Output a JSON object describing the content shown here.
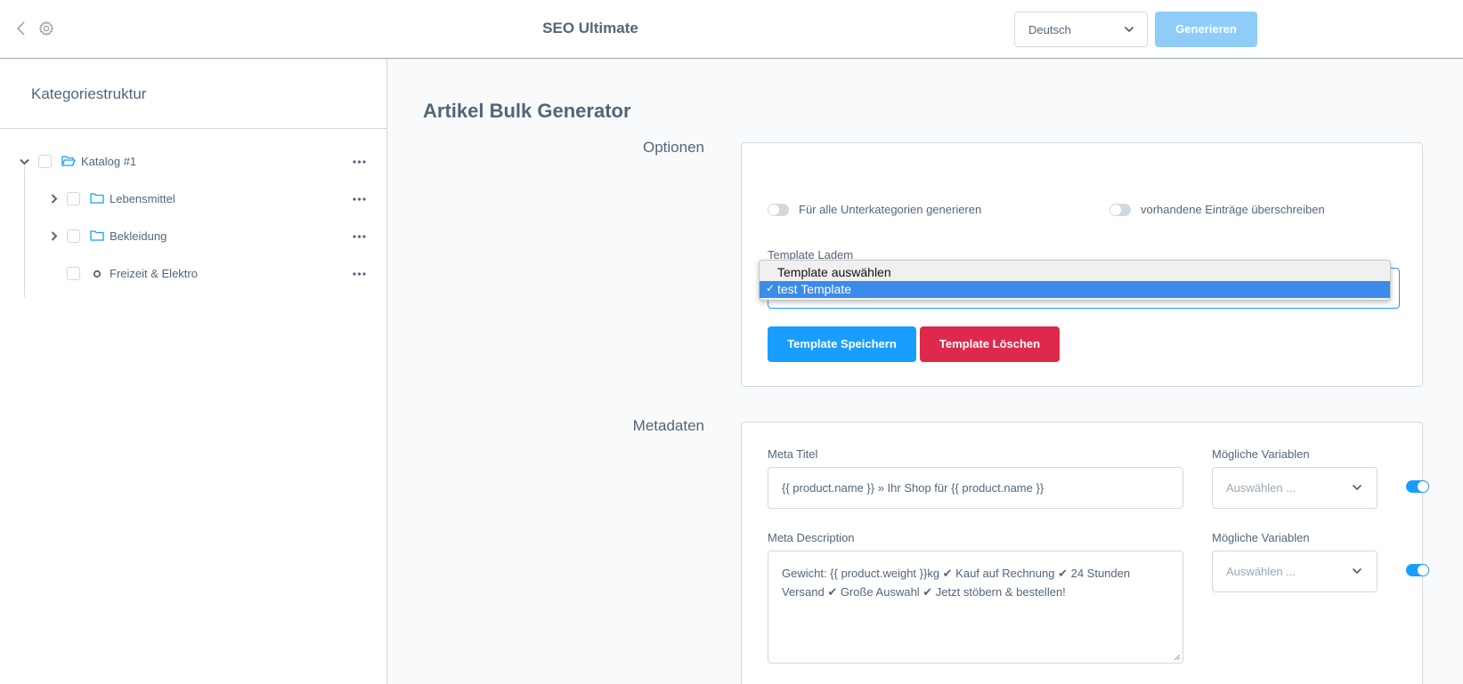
{
  "header": {
    "title": "SEO Ultimate",
    "language_value": "Deutsch",
    "generate_label": "Generieren"
  },
  "sidebar": {
    "title": "Kategoriestruktur",
    "items": [
      {
        "label": "Katalog #1"
      },
      {
        "label": "Lebensmittel"
      },
      {
        "label": "Bekleidung"
      },
      {
        "label": "Freizeit & Elektro"
      }
    ]
  },
  "main": {
    "page_title": "Artikel Bulk Generator",
    "options": {
      "section_label": "Optionen",
      "toggle_subcategories": "Für alle Unterkategorien generieren",
      "toggle_overwrite": "vorhandene Einträge überschreiben",
      "template_label": "Template Ladem",
      "dropdown_options": [
        {
          "label": "Template auswählen",
          "selected": false
        },
        {
          "label": "test Template",
          "selected": true
        }
      ],
      "check_mark": "✓",
      "save_label": "Template Speichern",
      "delete_label": "Template Löschen"
    },
    "metadata": {
      "section_label": "Metadaten",
      "meta_title_label": "Meta Titel",
      "meta_title_value": "{{ product.name }} » Ihr Shop für {{ product.name }}",
      "variables_label": "Mögliche Variablen",
      "variables_placeholder": "Auswählen ...",
      "meta_description_label": "Meta Description",
      "meta_description_value": "Gewicht:  {{ product.weight }}kg ✔ Kauf auf Rechnung ✔ 24 Stunden Versand ✔ Große Auswahl ✔ Jetzt stöbern & bestellen!"
    }
  },
  "colors": {
    "accent": "#189eff",
    "danger": "#de294c",
    "text": "#52667a"
  }
}
